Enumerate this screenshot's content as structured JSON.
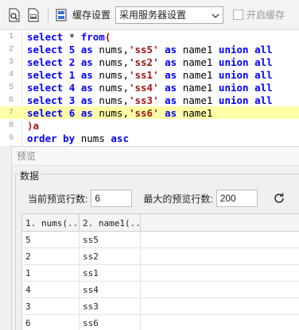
{
  "toolbar": {
    "cache_label": "缓存设置",
    "cache_select_value": "采用服务器设置",
    "enable_cache_label": "开启缓存"
  },
  "editor": {
    "lines": [
      {
        "n": "1"
      },
      {
        "n": "2"
      },
      {
        "n": "3"
      },
      {
        "n": "4"
      },
      {
        "n": "5"
      },
      {
        "n": "6"
      },
      {
        "n": "7"
      },
      {
        "n": "8"
      },
      {
        "n": "9"
      }
    ],
    "tokens": {
      "select": "select",
      "star": " * ",
      "from": "from",
      "paren_open": "(",
      "as": "as",
      "nums": "nums,",
      "name1": "name1",
      "union_all": "union all",
      "paren_close_a": ")a",
      "order_by": "order by",
      "nums_plain": "nums",
      "asc": "asc",
      "v5": "5",
      "v2": "2",
      "v1": "1",
      "v4": "4",
      "v3": "3",
      "v6": "6",
      "s5": "'ss5'",
      "s2": "'ss2'",
      "s1": "'ss1'",
      "s4": "'ss4'",
      "s3": "'ss3'",
      "s6": "'ss6'"
    }
  },
  "preview": {
    "title": "预览",
    "group_label": "数据",
    "current_rows_label": "当前预览行数:",
    "current_rows_value": "6",
    "max_rows_label": "最大的预览行数:",
    "max_rows_value": "200",
    "columns": [
      "1. nums(...",
      "2. name1(..."
    ],
    "rows": [
      [
        "5",
        "ss5"
      ],
      [
        "2",
        "ss2"
      ],
      [
        "1",
        "ss1"
      ],
      [
        "4",
        "ss4"
      ],
      [
        "3",
        "ss3"
      ],
      [
        "6",
        "ss6"
      ]
    ]
  },
  "icons": {
    "preview": "preview-doc-icon",
    "save": "save-doc-icon",
    "cache_settings": "cache-settings-icon",
    "refresh": "refresh-icon",
    "dropdown": "chevron-down-icon"
  },
  "colors": {
    "keyword": "#0000ff",
    "string": "#a31515",
    "highlight_line": "#ffffa8"
  }
}
